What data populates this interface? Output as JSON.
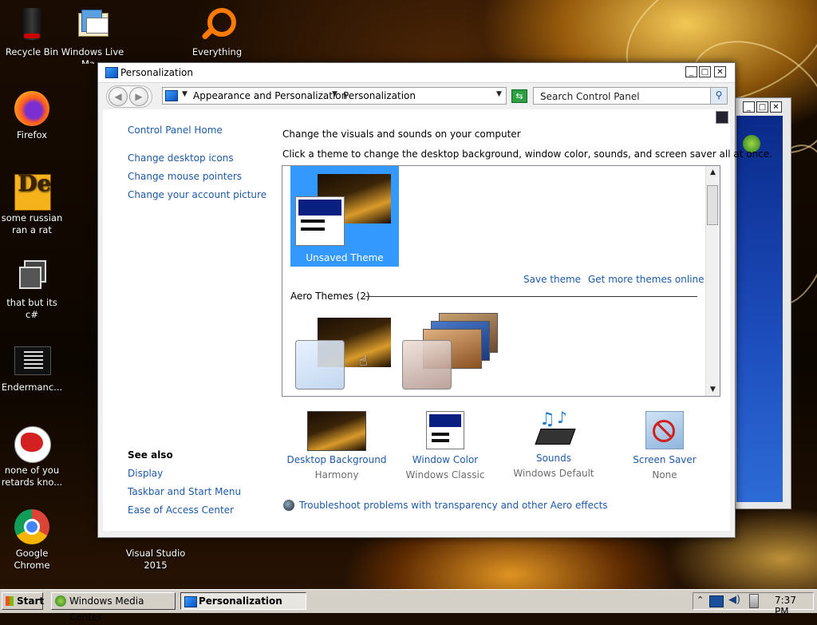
{
  "desktop": {
    "icons": [
      {
        "label": "Recycle Bin"
      },
      {
        "label": "Windows Live Ma..."
      },
      {
        "label": "Everything"
      },
      {
        "label": "Firefox"
      },
      {
        "label": "some russian ran a rat"
      },
      {
        "label": "that but its c#"
      },
      {
        "label": "Endermanc..."
      },
      {
        "label": "none of you retards kno..."
      },
      {
        "label": "Google Chrome"
      },
      {
        "label": "Visual Studio 2015"
      }
    ]
  },
  "window": {
    "title": "Personalization",
    "controls": {
      "minimize": "_",
      "maximize": "□",
      "close": "✕"
    },
    "address": {
      "crumbs": [
        "Appearance and Personalization",
        "Personalization"
      ]
    },
    "search": {
      "placeholder": "Search Control Panel"
    },
    "sidebar": {
      "home": "Control Panel Home",
      "links": [
        "Change desktop icons",
        "Change mouse pointers",
        "Change your account picture"
      ],
      "see_also_heading": "See also",
      "see_also": [
        "Display",
        "Taskbar and Start Menu",
        "Ease of Access Center"
      ]
    },
    "main": {
      "heading": "Change the visuals and sounds on your computer",
      "description": "Click a theme to change the desktop background, window color, sounds, and screen saver all at once.",
      "selected_theme": "Unsaved Theme",
      "save_theme": "Save theme",
      "get_more": "Get more themes online",
      "aero_heading": "Aero Themes (2)",
      "categories": [
        {
          "name": "Desktop Background",
          "value": "Harmony",
          "icon": "desktop-background-icon"
        },
        {
          "name": "Window Color",
          "value": "Windows Classic",
          "icon": "window-color-icon"
        },
        {
          "name": "Sounds",
          "value": "Windows Default",
          "icon": "sounds-icon"
        },
        {
          "name": "Screen Saver",
          "value": "None",
          "icon": "screen-saver-icon"
        }
      ],
      "troubleshoot": "Troubleshoot problems with transparency and other Aero effects"
    }
  },
  "taskbar": {
    "start": "Start",
    "buttons": [
      {
        "label": "Windows Media Center"
      },
      {
        "label": "Personalization",
        "active": true
      }
    ],
    "clock": "7:37 PM"
  }
}
